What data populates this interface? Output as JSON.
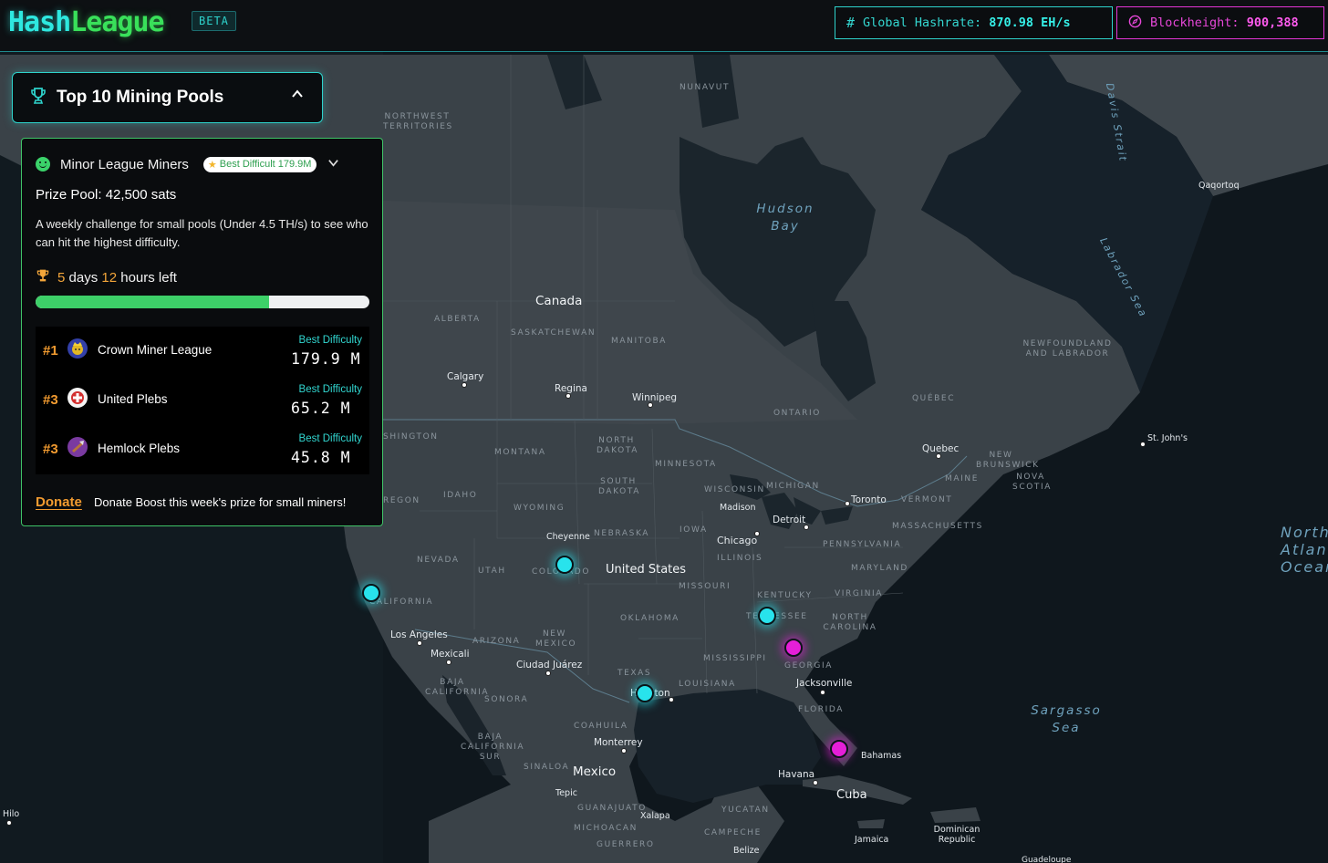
{
  "header": {
    "logo_part1": "Hash",
    "logo_part2": "League",
    "badge": "BETA",
    "hashrate_label": "Global Hashrate:",
    "hashrate_value": "870.98 EH/s",
    "block_label": "Blockheight:",
    "block_value": "900,388",
    "hash_icon": "hash-icon",
    "block_icon": "compass-icon",
    "accent_cyan": "#2ed3cc",
    "accent_magenta": "#e335d6"
  },
  "top10": {
    "title": "Top 10 Mining Pools",
    "icon": "trophy-icon",
    "toggle_icon": "chevron-up-icon"
  },
  "league": {
    "title": "Minor League Miners",
    "badge": "Best Difficult 179.9M",
    "prize": "Prize Pool: 42,500 sats",
    "description": "A weekly challenge for small pools (Under 4.5 TH/s) to see who can hit the highest difficulty.",
    "days": "5",
    "days_label": "days",
    "hours": "12",
    "hours_label": "hours left",
    "progress": 0.7,
    "leaders": [
      {
        "rank": "#1",
        "name": "Crown Miner League",
        "label": "Best Difficulty",
        "value": "179.9 M",
        "avatar": "crown-avatar-icon"
      },
      {
        "rank": "#3",
        "name": "United Plebs",
        "label": "Best Difficulty",
        "value": "65.2 M",
        "avatar": "united-plebs-avatar-icon"
      },
      {
        "rank": "#3",
        "name": "Hemlock Plebs",
        "label": "Best Difficulty",
        "value": "45.8 M",
        "avatar": "hemlock-avatar-icon"
      }
    ],
    "donate_link": "Donate",
    "donate_text": "Donate Boost this week's prize for small miners!"
  },
  "map": {
    "labels": {
      "nunavut": "NUNAVUT",
      "nwt": "NORTHWEST TERRITORIES",
      "hudson": "Hudson Bay",
      "davis": "Davis Strait",
      "labrador_sea": "Labrador Sea",
      "qaqortoq": "Qaqortoq",
      "canada": "Canada",
      "alberta": "ALBERTA",
      "saskatchewan": "SASKATCHEWAN",
      "manitoba": "MANITOBA",
      "newfoundland": "NEWFOUNDLAND AND LABRADOR",
      "calgary": "Calgary",
      "regina": "Regina",
      "winnipeg": "Winnipeg",
      "quebec_prov": "QUÉBEC",
      "ontario": "ONTARIO",
      "st_johns": "St. John's",
      "washington": "SHINGTON",
      "montana": "MONTANA",
      "north_dakota": "NORTH DAKOTA",
      "minnesota": "MINNESOTA",
      "quebec_city": "Quebec",
      "new_brunswick": "NEW BRUNSWICK",
      "maine": "MAINE",
      "nova_scotia": "NOVA SCOTIA",
      "oregon": "REGON",
      "idaho": "IDAHO",
      "south_dakota": "SOUTH DAKOTA",
      "wisconsin": "WISCONSIN",
      "michigan": "MICHIGAN",
      "toronto": "Toronto",
      "vermont": "VERMONT",
      "wyoming": "WYOMING",
      "madison": "Madison",
      "detroit": "Detroit",
      "massachusetts": "MASSACHUSETTS",
      "cheyenne": "Cheyenne",
      "nebraska": "NEBRASKA",
      "iowa": "IOWA",
      "chicago": "Chicago",
      "pennsylvania": "PENNSYLVANIA",
      "north_atlantic": "North Atlantic Ocean",
      "nevada": "NEVADA",
      "utah": "UTAH",
      "colorado": "COLORADO",
      "united_states": "United States",
      "illinois": "ILLINOIS",
      "maryland": "MARYLAND",
      "missouri": "MISSOURI",
      "california": "CALIFORNIA",
      "kentucky": "KENTUCKY",
      "virginia": "VIRGINIA",
      "oklahoma": "OKLAHOMA",
      "tennessee": "TENNESSEE",
      "north_carolina": "NORTH CAROLINA",
      "los_angeles": "Los Angeles",
      "arizona": "ARIZONA",
      "new_mexico": "NEW MEXICO",
      "mexicali": "Mexicali",
      "mississippi": "MISSISSIPPI",
      "georgia": "GEORGIA",
      "ciudad_juarez": "Ciudad Juárez",
      "texas": "TEXAS",
      "baja_california": "BAJA CALIFORNIA",
      "louisiana": "LOUISIANA",
      "jacksonville": "Jacksonville",
      "sonora": "SONORA",
      "houston": "Houston",
      "florida": "FLORIDA",
      "sargasso": "Sargasso Sea",
      "coahuila": "COAHUILA",
      "baja_california_sur": "BAJA CALIFORNIA SUR",
      "monterrey": "Monterrey",
      "bahamas": "Bahamas",
      "sinaloa": "SINALOA",
      "mexico": "Mexico",
      "havana": "Havana",
      "tepic": "Tepic",
      "cuba": "Cuba",
      "guanajuato": "GUANAJUATO",
      "yucatan": "YUCATAN",
      "hilo": "Hilo",
      "xalapa": "Xalapa",
      "michoacan": "MICHOACAN",
      "campeche": "CAMPECHE",
      "dominican": "Dominican Republic",
      "guerrero": "GUERRERO",
      "jamaica": "Jamaica",
      "belize": "Belize",
      "guadeloupe": "Guadeloupe"
    },
    "pool_markers": [
      {
        "name": "pool-marker-california",
        "color": "cyan"
      },
      {
        "name": "pool-marker-colorado",
        "color": "cyan"
      },
      {
        "name": "pool-marker-tennessee",
        "color": "cyan"
      },
      {
        "name": "pool-marker-georgia",
        "color": "magenta"
      },
      {
        "name": "pool-marker-houston",
        "color": "cyan"
      },
      {
        "name": "pool-marker-florida",
        "color": "magenta"
      }
    ]
  }
}
